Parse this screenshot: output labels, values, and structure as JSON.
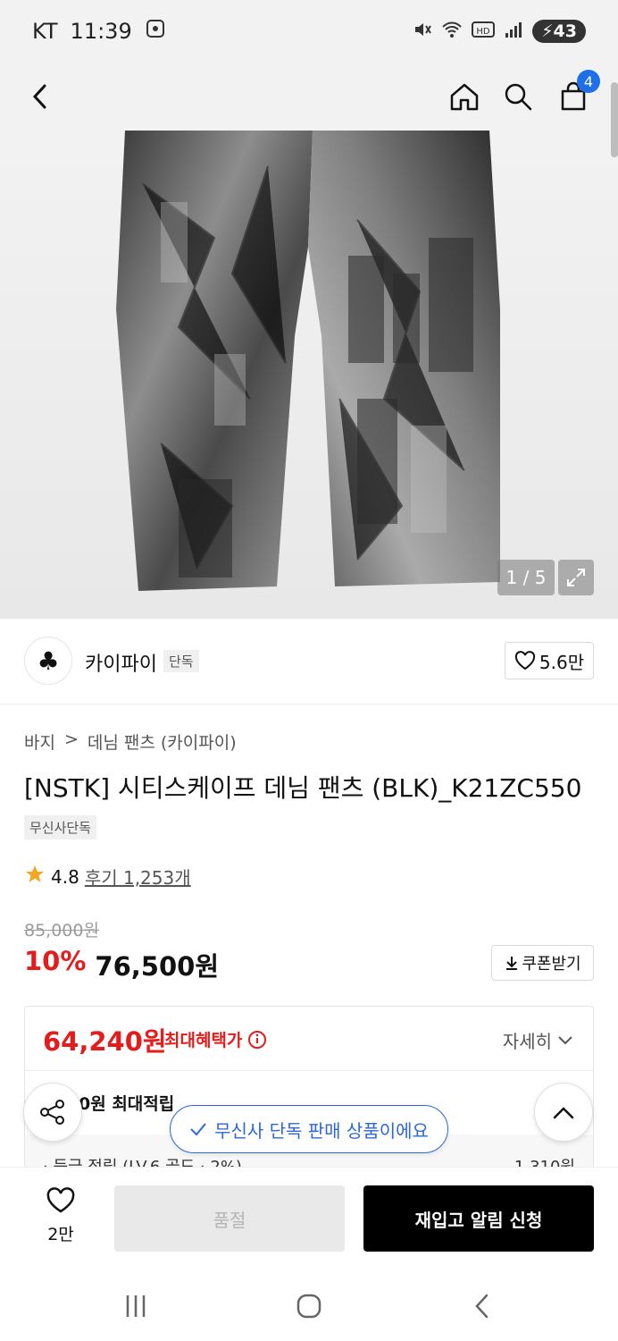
{
  "status": {
    "carrier": "KT",
    "time": "11:39",
    "battery": "43"
  },
  "nav": {
    "cart_count": "4"
  },
  "gallery": {
    "counter": "1 / 5"
  },
  "brand": {
    "name": "카이파이",
    "tag": "단독",
    "likes": "5.6만"
  },
  "breadcrumb": {
    "category": "바지",
    "separator": ">",
    "subcategory": "데님 팬츠 (카이파이)"
  },
  "product": {
    "title": "[NSTK] 시티스케이프 데님 팬츠 (BLK)_K21ZC550",
    "badge": "무신사단독",
    "rating": "4.8",
    "reviews": "후기 1,253개"
  },
  "price": {
    "original": "85,000원",
    "discount": "10%",
    "sale": "76,500원",
    "coupon_label": "쿠폰받기"
  },
  "benefit": {
    "max_price": "64,240원",
    "max_label": "최대혜택가",
    "detail_label": "자세히",
    "points_text": "0원 최대적립",
    "grade_label": "· 등급 적립 (LV.6 골드 · 2%)",
    "grade_value": "1,310원"
  },
  "toast": {
    "text": "무신사 단독 판매 상품이에요"
  },
  "bottom": {
    "wish_count": "2만",
    "soldout_label": "품절",
    "restock_label": "재입고 알림 신청"
  },
  "colors": {
    "accent_red": "#e41c1c",
    "accent_blue": "#2b67d8",
    "badge_blue": "#1e6fe8"
  }
}
